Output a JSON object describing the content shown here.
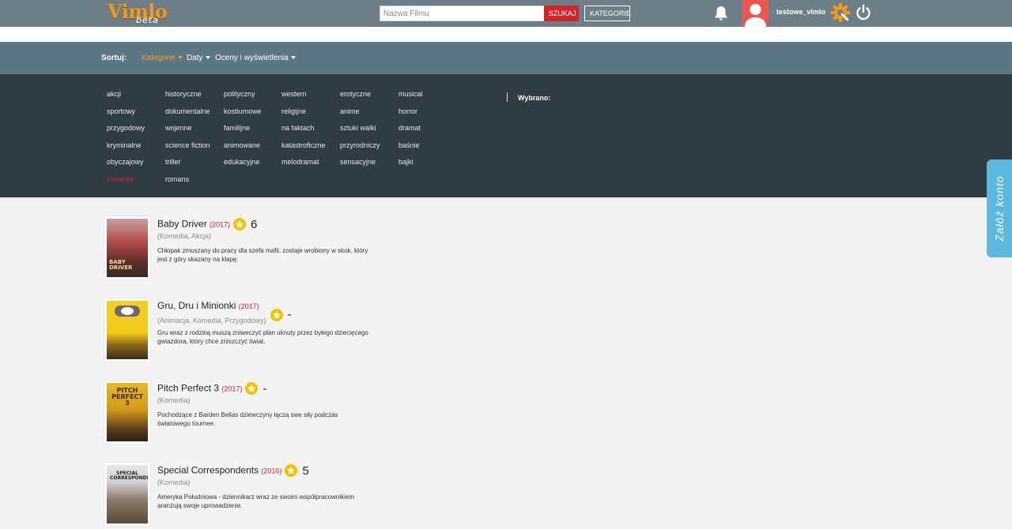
{
  "header": {
    "logo_main": "Vimlo",
    "logo_sub": "beta",
    "search_placeholder": "Nazwa Filmu",
    "search_button": "SZUKAJ",
    "categories_button": "KATEGORIE",
    "username": "testowe_vimlo"
  },
  "sort": {
    "label": "Sortuj:",
    "options": [
      {
        "label": "Kategorie"
      },
      {
        "label": "Daty"
      },
      {
        "label": "Oceny i wyświetlenia"
      }
    ]
  },
  "categories": {
    "columns": [
      [
        "akcji",
        "sportowy",
        "przygodowy",
        "kryminalne",
        "obyczajowy",
        "komedie"
      ],
      [
        "historyczne",
        "dokumentalne",
        "wojenne",
        "science fiction",
        "triller",
        "romans"
      ],
      [
        "polityczny",
        "kostiumowe",
        "familijne",
        "animowane",
        "edukacyjne"
      ],
      [
        "western",
        "religijne",
        "na faktach",
        "katastroficzne",
        "melodramat"
      ],
      [
        "erotyczne",
        "anime",
        "sztuki walki",
        "przyrodniczy",
        "sensacyjne"
      ],
      [
        "musical",
        "horror",
        "dramat",
        "baśnie",
        "bajki"
      ]
    ],
    "selected": "komedie",
    "chosen_label": "Wybrano:"
  },
  "register_tab": "Załóż konto",
  "movies": [
    {
      "title": "Baby Driver",
      "year": "(2017)",
      "rating": "6",
      "genres": "(Komedia, Akcja)",
      "description": "Chłopak zmuszany do pracy dla szefa mafii, zostaje wrobiony w skok, który jest z góry skazany na klapę.",
      "poster_text": "BABY DRIVER"
    },
    {
      "title": "Gru, Dru i Minionki",
      "year": "(2017)",
      "rating": "-",
      "genres": "(Animacja, Komedia, Przygodowy)",
      "description": "Gru wraz z rodziną muszą zniweczyć plan uknuty przez byłego dziecięcego gwiazdora, który chce zniszczyć świat.",
      "poster_text": ""
    },
    {
      "title": "Pitch Perfect 3",
      "year": "(2017)",
      "rating": "-",
      "genres": "(Komedia)",
      "description": "Pochodzące z Barden Bellas dziewczyny łączą swe siły podczas światowego tournee.",
      "poster_text": "PITCH PERFECT 3"
    },
    {
      "title": "Special Correspondents",
      "year": "(2016)",
      "rating": "5",
      "genres": "(Komedia)",
      "description": "Ameryka Południowa - dziennikarz wraz ze swoim współpracownikiem aranżują swoje uprowadzenie.",
      "poster_text": "SPECIAL CORRESPONDENTS"
    }
  ]
}
